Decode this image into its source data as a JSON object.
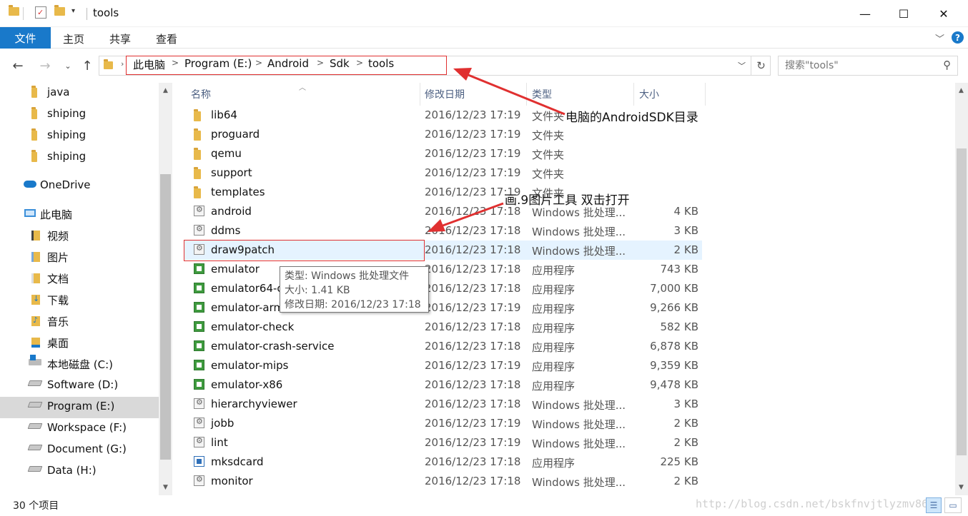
{
  "window": {
    "title": "tools",
    "minimize": "—",
    "maximize": "☐",
    "close": "✕"
  },
  "ribbon": {
    "file_tab": "文件",
    "tabs": [
      "主页",
      "共享",
      "查看"
    ]
  },
  "address": {
    "path": [
      "此电脑",
      "Program (E:)",
      "Android",
      "Sdk",
      "tools"
    ],
    "search_placeholder": "搜索\"tools\""
  },
  "nav": {
    "items": [
      {
        "label": "java",
        "icon": "folder-icon"
      },
      {
        "label": "shiping",
        "icon": "folder-icon"
      },
      {
        "label": "shiping",
        "icon": "folder-icon"
      },
      {
        "label": "shiping",
        "icon": "folder-icon"
      },
      {
        "label": "OneDrive",
        "icon": "cloud-icon"
      },
      {
        "label": "此电脑",
        "icon": "computer-icon"
      },
      {
        "label": "视频",
        "icon": "video-icon"
      },
      {
        "label": "图片",
        "icon": "picture-icon"
      },
      {
        "label": "文档",
        "icon": "document-icon"
      },
      {
        "label": "下载",
        "icon": "download-icon"
      },
      {
        "label": "音乐",
        "icon": "music-icon"
      },
      {
        "label": "桌面",
        "icon": "desktop-icon"
      },
      {
        "label": "本地磁盘 (C:)",
        "icon": "windows-drive-icon"
      },
      {
        "label": "Software (D:)",
        "icon": "drive-icon"
      },
      {
        "label": "Program (E:)",
        "icon": "drive-icon"
      },
      {
        "label": "Workspace (F:)",
        "icon": "drive-icon"
      },
      {
        "label": "Document (G:)",
        "icon": "drive-icon"
      },
      {
        "label": "Data (H:)",
        "icon": "drive-icon"
      }
    ]
  },
  "columns": {
    "name": "名称",
    "date": "修改日期",
    "type": "类型",
    "size": "大小"
  },
  "files": [
    {
      "name": "lib64",
      "date": "2016/12/23 17:19",
      "type": "文件夹",
      "size": "",
      "icon": "folder-icon"
    },
    {
      "name": "proguard",
      "date": "2016/12/23 17:19",
      "type": "文件夹",
      "size": "",
      "icon": "folder-icon"
    },
    {
      "name": "qemu",
      "date": "2016/12/23 17:19",
      "type": "文件夹",
      "size": "",
      "icon": "folder-icon"
    },
    {
      "name": "support",
      "date": "2016/12/23 17:19",
      "type": "文件夹",
      "size": "",
      "icon": "folder-icon"
    },
    {
      "name": "templates",
      "date": "2016/12/23 17:19",
      "type": "文件夹",
      "size": "",
      "icon": "folder-icon"
    },
    {
      "name": "android",
      "date": "2016/12/23 17:18",
      "type": "Windows 批处理...",
      "size": "4 KB",
      "icon": "batch-file-icon"
    },
    {
      "name": "ddms",
      "date": "2016/12/23 17:18",
      "type": "Windows 批处理...",
      "size": "3 KB",
      "icon": "batch-file-icon"
    },
    {
      "name": "draw9patch",
      "date": "2016/12/23 17:18",
      "type": "Windows 批处理...",
      "size": "2 KB",
      "icon": "batch-file-icon"
    },
    {
      "name": "emulator",
      "date": "2016/12/23 17:18",
      "type": "应用程序",
      "size": "743 KB",
      "icon": "exe-icon"
    },
    {
      "name": "emulator64-c",
      "date": "2016/12/23 17:18",
      "type": "应用程序",
      "size": "7,000 KB",
      "icon": "exe-icon"
    },
    {
      "name": "emulator-arm",
      "date": "2016/12/23 17:19",
      "type": "应用程序",
      "size": "9,266 KB",
      "icon": "exe-icon"
    },
    {
      "name": "emulator-check",
      "date": "2016/12/23 17:18",
      "type": "应用程序",
      "size": "582 KB",
      "icon": "exe-icon"
    },
    {
      "name": "emulator-crash-service",
      "date": "2016/12/23 17:18",
      "type": "应用程序",
      "size": "6,878 KB",
      "icon": "exe-icon"
    },
    {
      "name": "emulator-mips",
      "date": "2016/12/23 17:19",
      "type": "应用程序",
      "size": "9,359 KB",
      "icon": "exe-icon"
    },
    {
      "name": "emulator-x86",
      "date": "2016/12/23 17:18",
      "type": "应用程序",
      "size": "9,478 KB",
      "icon": "exe-icon"
    },
    {
      "name": "hierarchyviewer",
      "date": "2016/12/23 17:18",
      "type": "Windows 批处理...",
      "size": "3 KB",
      "icon": "batch-file-icon"
    },
    {
      "name": "jobb",
      "date": "2016/12/23 17:19",
      "type": "Windows 批处理...",
      "size": "2 KB",
      "icon": "batch-file-icon"
    },
    {
      "name": "lint",
      "date": "2016/12/23 17:19",
      "type": "Windows 批处理...",
      "size": "2 KB",
      "icon": "batch-file-icon"
    },
    {
      "name": "mksdcard",
      "date": "2016/12/23 17:18",
      "type": "应用程序",
      "size": "225 KB",
      "icon": "exe-window-icon"
    },
    {
      "name": "monitor",
      "date": "2016/12/23 17:18",
      "type": "Windows 批处理...",
      "size": "2 KB",
      "icon": "batch-file-icon"
    }
  ],
  "tooltip": {
    "line1": "类型: Windows 批处理文件",
    "line2": "大小: 1.41 KB",
    "line3": "修改日期: 2016/12/23 17:18"
  },
  "annotations": {
    "sdk_dir": "电脑的AndroidSDK目录",
    "nine_patch": "画.9图片工具  双击打开",
    "accent_color": "#e03030"
  },
  "status": {
    "count": "30 个项目",
    "watermark": "http://blog.csdn.net/bskfnvjtlyzmv867"
  },
  "colors": {
    "file_tab": "#1979ca",
    "selection": "#e5f3ff",
    "nav_selected": "#d9d9d9"
  }
}
